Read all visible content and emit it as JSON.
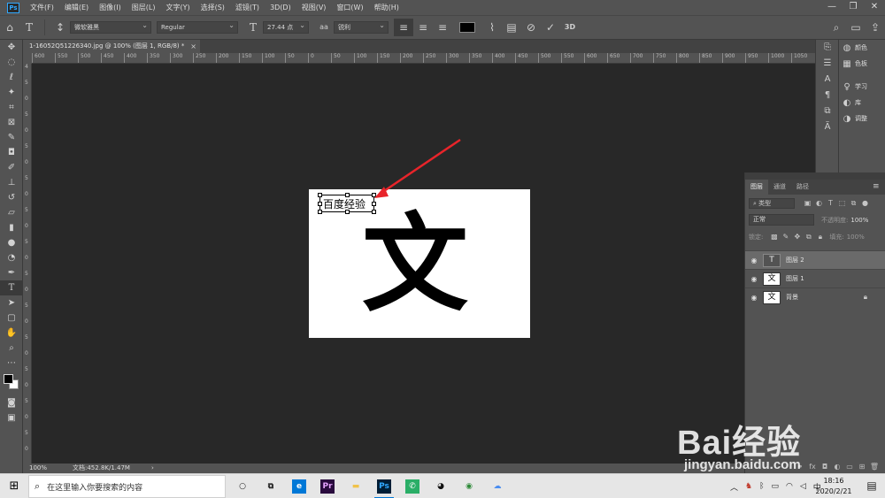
{
  "app": {
    "logo": "Ps"
  },
  "menu": [
    "文件(F)",
    "编辑(E)",
    "图像(I)",
    "图层(L)",
    "文字(Y)",
    "选择(S)",
    "滤镜(T)",
    "3D(D)",
    "视图(V)",
    "窗口(W)",
    "帮助(H)"
  ],
  "options": {
    "font_family": "微软雅黑",
    "font_style": "Regular",
    "font_size": "27.44 点",
    "aa_label": "aa",
    "antialias": "锐利",
    "text_color": "#000000",
    "mode_3d": "3D"
  },
  "document": {
    "tab_title": "1-16052Q51226340.jpg @ 100% (图层 1, RGB/8) *",
    "close": "×",
    "big_char": "文",
    "text_layer_text": "百度经验"
  },
  "ruler": {
    "h": [
      "600",
      "550",
      "500",
      "450",
      "400",
      "350",
      "300",
      "250",
      "200",
      "150",
      "100",
      "50",
      "0",
      "50",
      "100",
      "150",
      "200",
      "250",
      "300",
      "350",
      "400",
      "450",
      "500",
      "550",
      "600",
      "650",
      "700",
      "750",
      "800",
      "850",
      "900",
      "950",
      "1000",
      "1050"
    ],
    "v": [
      "4",
      "5",
      "0",
      "5",
      "0",
      "5",
      "0",
      "5",
      "0",
      "5",
      "0",
      "5",
      "0",
      "5",
      "0",
      "5",
      "0",
      "5",
      "0",
      "5",
      "0",
      "5",
      "0",
      "5",
      "0"
    ]
  },
  "status": {
    "zoom": "100%",
    "doc_info": "文档:452.8K/1.47M",
    "arrow": "›"
  },
  "right_panels": [
    {
      "icon": "palette-icon",
      "label": "颜色"
    },
    {
      "icon": "grid-icon",
      "label": "色板"
    },
    {
      "icon": "bulb-icon",
      "label": "学习"
    },
    {
      "icon": "library-icon",
      "label": "库"
    },
    {
      "icon": "adjust-icon",
      "label": "调整"
    }
  ],
  "layers_panel": {
    "tabs": [
      "图层",
      "通道",
      "路径"
    ],
    "filter_label": "类型",
    "blend_mode": "正常",
    "opacity_label": "不透明度:",
    "opacity_value": "100%",
    "lock_label": "锁定:",
    "fill_label": "填充:",
    "fill_value": "100%",
    "layers": [
      {
        "name": "图层 2",
        "thumb": "T",
        "selected": true
      },
      {
        "name": "图层 1",
        "thumb": "文",
        "selected": false
      },
      {
        "name": "背景",
        "thumb": "文",
        "selected": false,
        "locked": true
      }
    ]
  },
  "taskbar": {
    "search_placeholder": "在这里输入你要搜索的内容",
    "apps": [
      {
        "name": "cortana",
        "glyph": "○",
        "color": "#222222",
        "bg": "transparent"
      },
      {
        "name": "task-view",
        "glyph": "⧉",
        "color": "#222222",
        "bg": "transparent"
      },
      {
        "name": "edge",
        "glyph": "e",
        "color": "#ffffff",
        "bg": "#0078d7"
      },
      {
        "name": "premiere",
        "glyph": "Pr",
        "color": "#e6a3ff",
        "bg": "#2a0b3e"
      },
      {
        "name": "explorer",
        "glyph": "▬",
        "color": "#f0c24a",
        "bg": "transparent"
      },
      {
        "name": "photoshop",
        "glyph": "Ps",
        "color": "#31a8ff",
        "bg": "#001e36"
      },
      {
        "name": "wechat",
        "glyph": "✆",
        "color": "#ffffff",
        "bg": "#2aae67"
      },
      {
        "name": "qq",
        "glyph": "◕",
        "color": "#111111",
        "bg": "transparent"
      },
      {
        "name": "chrome",
        "glyph": "◉",
        "color": "#2f8a39",
        "bg": "transparent"
      },
      {
        "name": "cloud",
        "glyph": "☁",
        "color": "#4a8df0",
        "bg": "transparent"
      }
    ],
    "tray": {
      "ime": "中",
      "time": "18:16",
      "date": "2020/2/21"
    }
  },
  "watermark": {
    "main": "Bai经验",
    "sub": "jingyan.baidu.com"
  }
}
